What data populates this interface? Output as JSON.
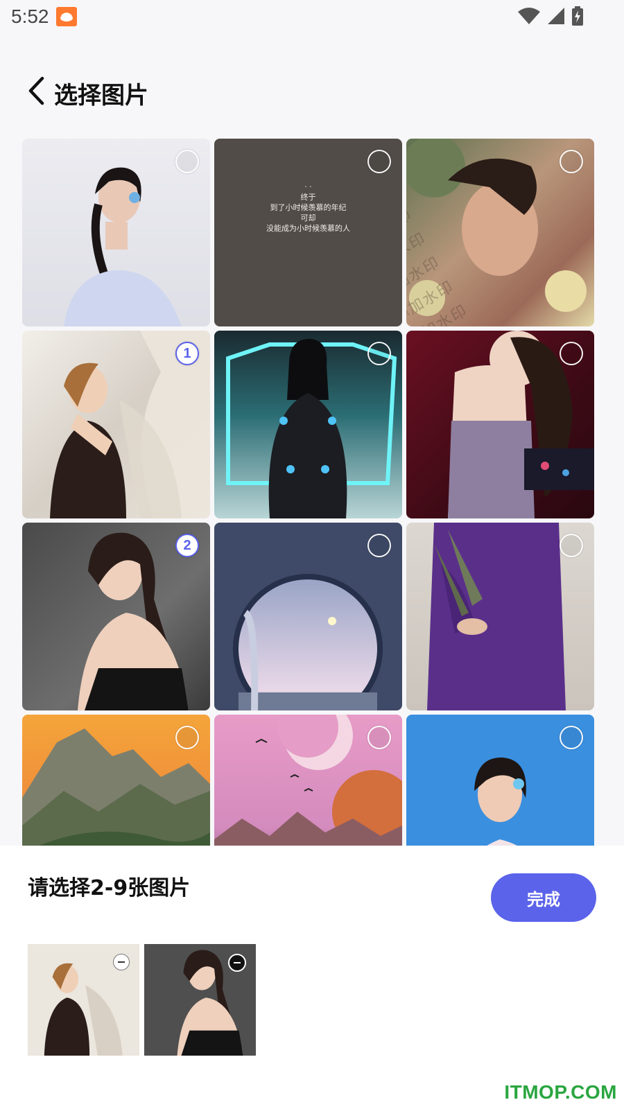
{
  "status_bar": {
    "time": "5:52",
    "icons": [
      "app-notification-icon",
      "wifi-icon",
      "signal-icon",
      "battery-charging-icon"
    ]
  },
  "header": {
    "title": "选择图片",
    "back_icon": "chevron-left-icon"
  },
  "grid": {
    "tiles": [
      {
        "subject": "portrait-white-dress",
        "selected": false,
        "order": ""
      },
      {
        "subject": "text-card",
        "selected": false,
        "order": "",
        "caption": "· ·\n终于\n到了小时候羡慕的年纪\n可却\n没能成为小时候羡慕的人"
      },
      {
        "subject": "portrait-flowers-watermark",
        "selected": false,
        "order": "",
        "watermark": "添加水印"
      },
      {
        "subject": "portrait-lace-curtain",
        "selected": true,
        "order": "1"
      },
      {
        "subject": "cosplay-neon",
        "selected": false,
        "order": ""
      },
      {
        "subject": "portrait-back-red",
        "selected": false,
        "order": ""
      },
      {
        "subject": "portrait-black-dress",
        "selected": true,
        "order": "2"
      },
      {
        "subject": "moon-window",
        "selected": false,
        "order": ""
      },
      {
        "subject": "purple-dress-flowers",
        "selected": false,
        "order": ""
      },
      {
        "subject": "mountain-sunset",
        "selected": false,
        "order": ""
      },
      {
        "subject": "pink-moon-birds",
        "selected": false,
        "order": ""
      },
      {
        "subject": "portrait-blue-bg",
        "selected": false,
        "order": ""
      }
    ]
  },
  "bottom_sheet": {
    "hint": "请选择2-9张图片",
    "done_label": "完成",
    "selected_thumbs": [
      {
        "subject": "portrait-lace-curtain",
        "remove_icon": "minus-circle-icon"
      },
      {
        "subject": "portrait-black-dress",
        "remove_icon": "minus-circle-icon"
      }
    ]
  },
  "brand_watermark": "ITMOP.COM",
  "colors": {
    "accent": "#5b63ea",
    "brand_watermark": "#2aa640"
  }
}
